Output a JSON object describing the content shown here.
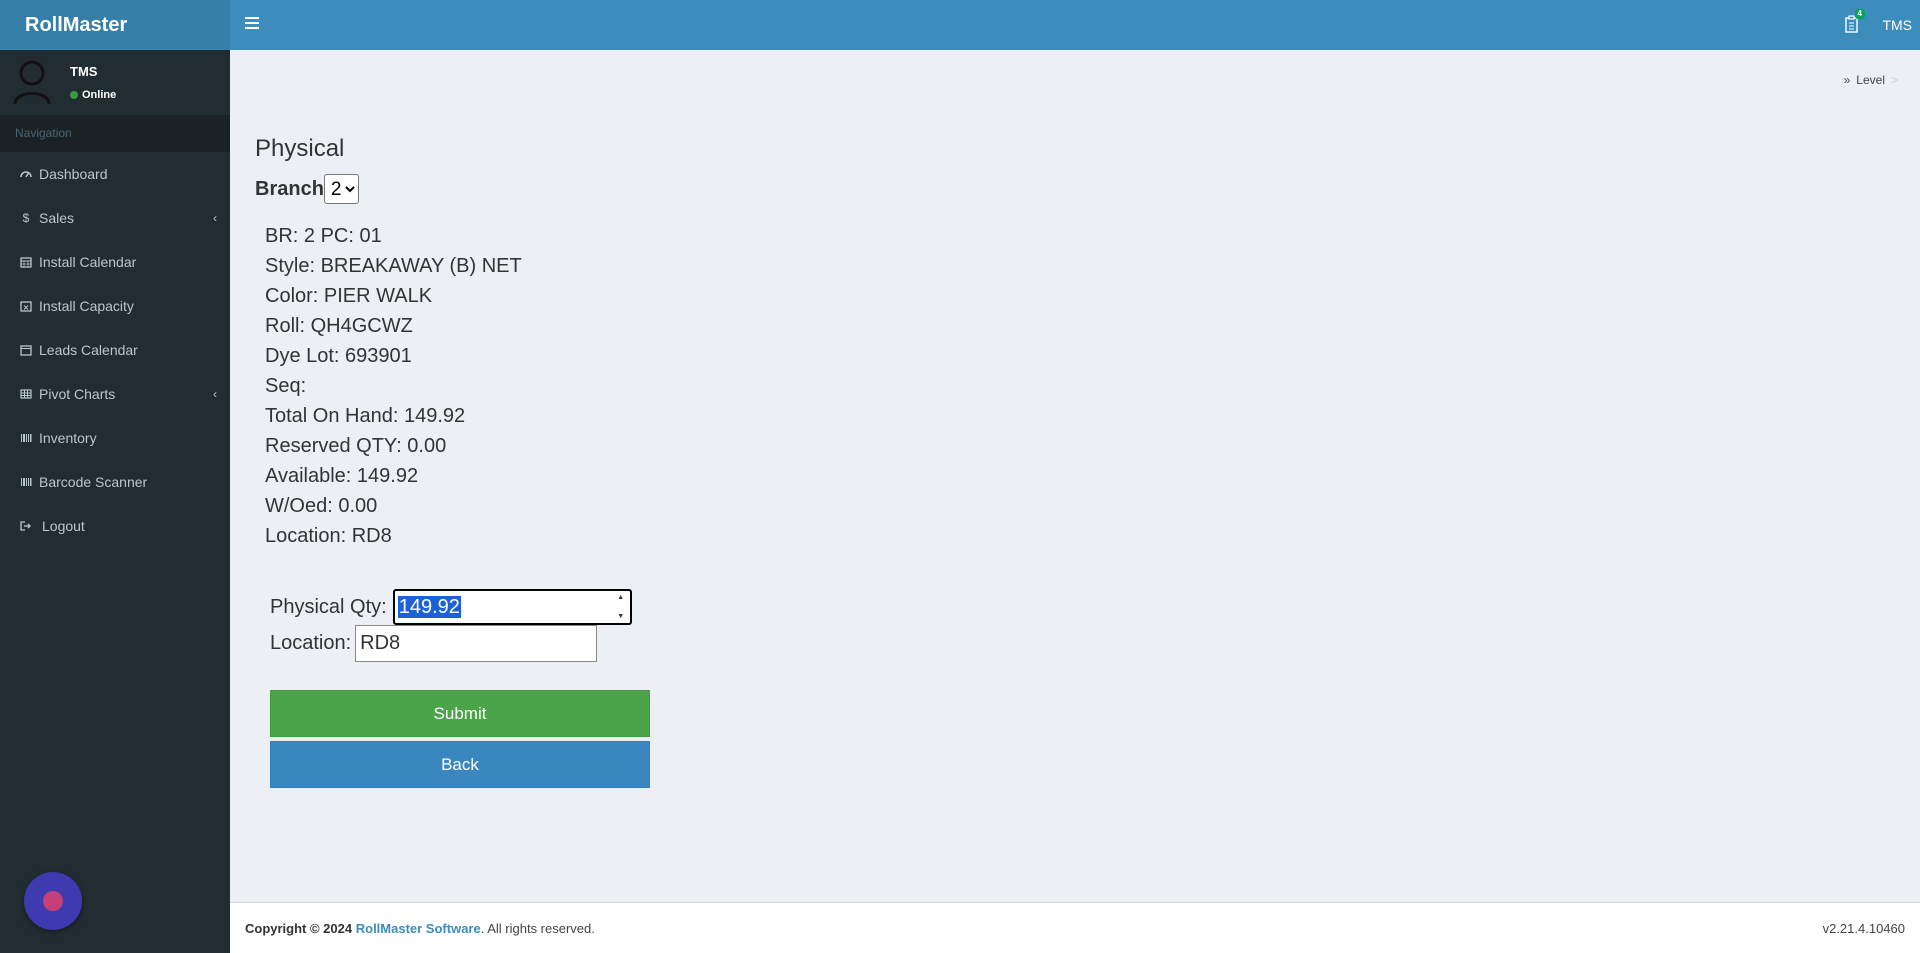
{
  "app": {
    "logo": "RollMaster"
  },
  "user": {
    "name": "TMS",
    "status": "Online"
  },
  "sidebar": {
    "header": "Navigation",
    "items": [
      {
        "label": "Dashboard",
        "icon": "dashboard-icon"
      },
      {
        "label": "Sales",
        "icon": "dollar-icon",
        "has_submenu": true
      },
      {
        "label": "Install Calendar",
        "icon": "calendar-icon"
      },
      {
        "label": "Install Capacity",
        "icon": "calendar-x-icon"
      },
      {
        "label": "Leads Calendar",
        "icon": "calendar-outline-icon"
      },
      {
        "label": "Pivot Charts",
        "icon": "table-icon",
        "has_submenu": true
      },
      {
        "label": "Inventory",
        "icon": "barcode-icon"
      },
      {
        "label": "Barcode Scanner",
        "icon": "barcode-icon"
      },
      {
        "label": "Logout",
        "icon": "sign-out-icon"
      }
    ]
  },
  "topbar": {
    "badge": "4",
    "user": "TMS"
  },
  "breadcrumb": {
    "item": "Level",
    "separator": ">"
  },
  "page": {
    "title": "Physical",
    "branch_label": "Branch",
    "branch_value": "2",
    "info": [
      "BR: 2 PC: 01",
      "Style: BREAKAWAY (B) NET",
      "Color: PIER WALK",
      "Roll: QH4GCWZ",
      "Dye Lot: 693901",
      "Seq:",
      "Total On Hand: 149.92",
      "Reserved QTY: 0.00",
      "Available: 149.92",
      "W/Oed: 0.00",
      "Location: RD8"
    ],
    "form": {
      "qty_label": "Physical Qty:",
      "qty_value": "149.92",
      "location_label": "Location:",
      "location_value": "RD8"
    },
    "buttons": {
      "submit": "Submit",
      "back": "Back"
    }
  },
  "footer": {
    "copyright_prefix": "Copyright © 2024",
    "brand": "RollMaster Software",
    "suffix": ". All rights reserved.",
    "version": "v2.21.4.10460"
  },
  "colors": {
    "sidebar_bg": "#222d32",
    "header_bg": "#3c8dbc",
    "logo_bg": "#367fa9",
    "submit": "#4ba449",
    "back": "#3a87bf"
  }
}
